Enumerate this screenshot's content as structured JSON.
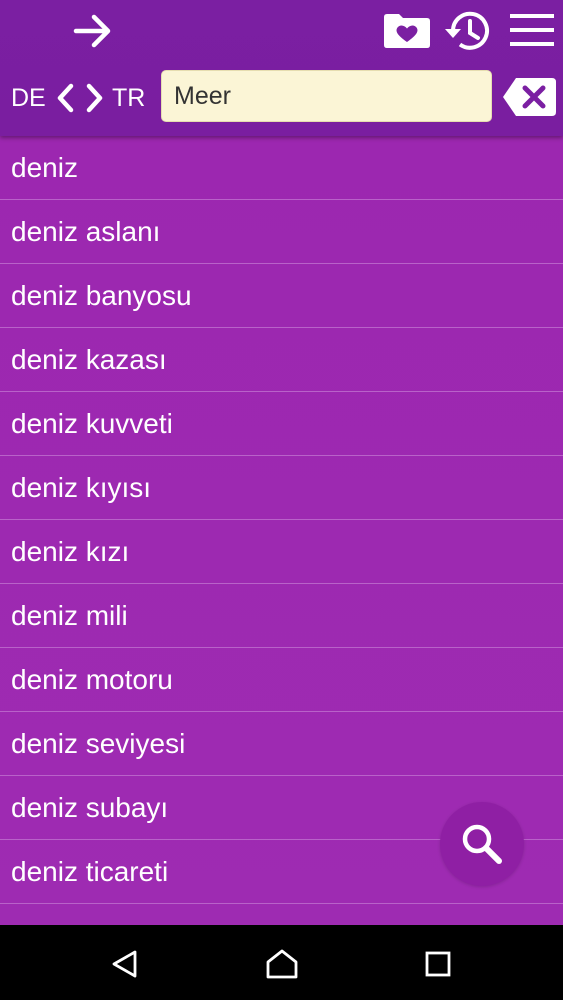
{
  "toolbar": {
    "forward_icon": "arrow-right-icon",
    "favorites_icon": "folder-heart-icon",
    "history_icon": "history-icon",
    "menu_icon": "menu-icon"
  },
  "language": {
    "source": "DE",
    "target": "TR",
    "swap_icon": "swap-chevrons-icon"
  },
  "search": {
    "value": "Meer",
    "clear_icon": "backspace-clear-icon"
  },
  "results": [
    "deniz",
    "deniz aslanı",
    "deniz banyosu",
    "deniz kazası",
    "deniz kuvveti",
    "deniz kıyısı",
    "deniz kızı",
    "deniz mili",
    "deniz motoru",
    "deniz seviyesi",
    "deniz subayı",
    "deniz ticareti"
  ],
  "fab": {
    "icon": "search-icon"
  },
  "navbar": {
    "back_icon": "back-triangle-icon",
    "home_icon": "home-icon",
    "recents_icon": "recents-square-icon"
  },
  "colors": {
    "toolbar": "#7b1fa2",
    "list_bg": "#9c27b0",
    "divider": "#b962c9",
    "search_bg": "#fbf5d6",
    "fab_bg": "#8f1fa4"
  }
}
